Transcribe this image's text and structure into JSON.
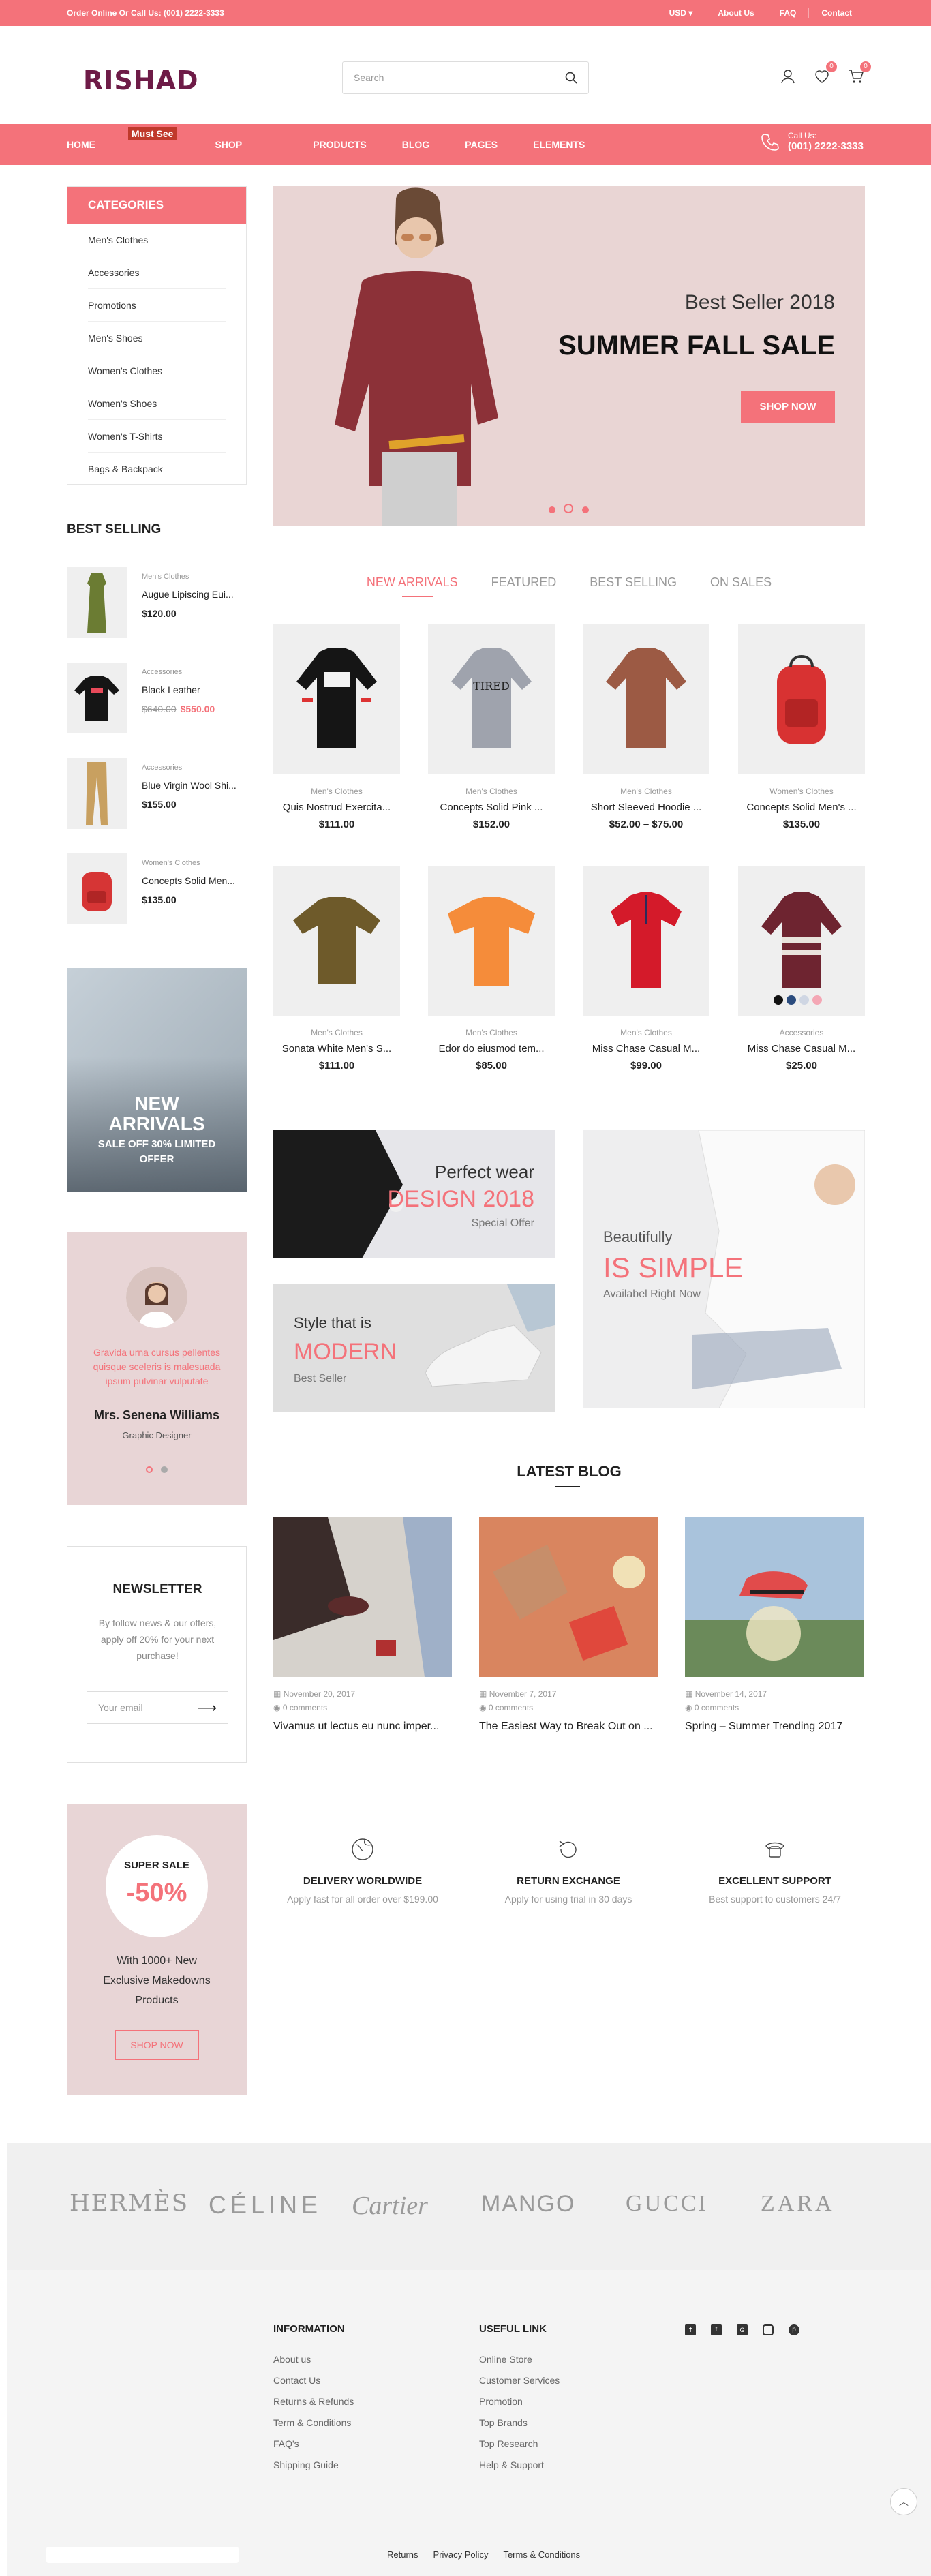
{
  "topbar": {
    "left": "Order Online Or Call Us: (001) 2222-3333",
    "currency": "USD",
    "about": "About Us",
    "faq": "FAQ",
    "contact": "Contact"
  },
  "header": {
    "logo": "RISHAD",
    "search_placeholder": "Search",
    "wishlist_count": "0",
    "cart_count": "0"
  },
  "nav": {
    "items": [
      "HOME",
      "SHOP",
      "PRODUCTS",
      "BLOG",
      "PAGES",
      "ELEMENTS"
    ],
    "shop_badge": "Must See",
    "call_label": "Call Us:",
    "call_number": "(001) 2222-3333"
  },
  "categories": {
    "title": "CATEGORIES",
    "items": [
      "Men's Clothes",
      "Accessories",
      "Promotions",
      "Men's Shoes",
      "Women's Clothes",
      "Women's Shoes",
      "Women's T-Shirts",
      "Bags & Backpack"
    ]
  },
  "best_selling": {
    "title": "BEST SELLING",
    "items": [
      {
        "cat": "Men's Clothes",
        "name": "Augue Lipiscing Eui...",
        "price": "$120.00",
        "old": ""
      },
      {
        "cat": "Accessories",
        "name": "Black Leather",
        "price": "$550.00",
        "old": "$640.00"
      },
      {
        "cat": "Accessories",
        "name": "Blue Virgin Wool Shi...",
        "price": "$155.00",
        "old": ""
      },
      {
        "cat": "Women's Clothes",
        "name": "Concepts Solid Men...",
        "price": "$135.00",
        "old": ""
      }
    ]
  },
  "promo_left": {
    "line1": "NEW",
    "line2": "ARRIVALS",
    "line3": "SALE OFF 30% LIMITED",
    "line4": "OFFER"
  },
  "testimonial": {
    "text": "Gravida urna cursus pellentes quisque sceleris is malesuada ipsum pulvinar vulputate",
    "name": "Mrs. Senena Williams",
    "role": "Graphic Designer"
  },
  "newsletter": {
    "title": "NEWSLETTER",
    "text": "By follow news & our offers, apply off 20% for your next purchase!",
    "placeholder": "Your email"
  },
  "sale_box": {
    "label": "SUPER SALE",
    "percent": "-50%",
    "text": "With 1000+ New Exclusive Makedowns Products",
    "button": "SHOP NOW"
  },
  "slider": {
    "subtitle": "Best Seller 2018",
    "title": "SUMMER FALL SALE",
    "button": "SHOP NOW"
  },
  "tabs": [
    "NEW ARRIVALS",
    "FEATURED",
    "BEST SELLING",
    "ON SALES"
  ],
  "products": [
    {
      "cat": "Men's Clothes",
      "name": "Quis Nostrud Exercita...",
      "price": "$111.00"
    },
    {
      "cat": "Men's Clothes",
      "name": "Concepts Solid Pink ...",
      "price": "$152.00"
    },
    {
      "cat": "Men's Clothes",
      "name": "Short Sleeved Hoodie ...",
      "price": "$52.00 – $75.00"
    },
    {
      "cat": "Women's Clothes",
      "name": "Concepts Solid Men's ...",
      "price": "$135.00"
    },
    {
      "cat": "Men's Clothes",
      "name": "Sonata White Men's S...",
      "price": "$111.00"
    },
    {
      "cat": "Men's Clothes",
      "name": "Edor do eiusmod tem...",
      "price": "$85.00"
    },
    {
      "cat": "Men's Clothes",
      "name": "Miss Chase Casual M...",
      "price": "$99.00"
    },
    {
      "cat": "Accessories",
      "name": "Miss Chase Casual M...",
      "price": "$25.00"
    }
  ],
  "tshirt_print": "TIRED",
  "banners": {
    "b1": {
      "l1": "Perfect wear",
      "l2": "DESIGN 2018",
      "l3": "Special Offer"
    },
    "b2": {
      "l1": "Style that is",
      "l2": "MODERN",
      "l3": "Best Seller"
    },
    "b3": {
      "l1": "Beautifully",
      "l2": "IS SIMPLE",
      "l3": "Availabel Right Now"
    }
  },
  "blog": {
    "title": "LATEST BLOG",
    "posts": [
      {
        "date": "November 20, 2017",
        "comments": "0 comments",
        "title": "Vivamus ut lectus eu nunc imper..."
      },
      {
        "date": "November 7, 2017",
        "comments": "0 comments",
        "title": "The Easiest Way to Break Out on ..."
      },
      {
        "date": "November 14, 2017",
        "comments": "0 comments",
        "title": "Spring – Summer Trending 2017"
      }
    ]
  },
  "features": [
    {
      "title": "DELIVERY WORLDWIDE",
      "sub": "Apply fast for all order over $199.00"
    },
    {
      "title": "RETURN EXCHANGE",
      "sub": "Apply for using trial in 30 days"
    },
    {
      "title": "EXCELLENT SUPPORT",
      "sub": "Best support to customers 24/7"
    }
  ],
  "brands": [
    "HERMÈS",
    "CÉLINE",
    "Cartier",
    "MANGO",
    "GUCCI",
    "ZARA"
  ],
  "footer": {
    "info_title": "INFORMATION",
    "info_links": [
      "About us",
      "Contact Us",
      "Returns & Refunds",
      "Term & Conditions",
      "FAQ's",
      "Shipping Guide"
    ],
    "useful_title": "USEFUL LINK",
    "useful_links": [
      "Online Store",
      "Customer Services",
      "Promotion",
      "Top Brands",
      "Top Research",
      "Help & Support"
    ],
    "bottom_links": [
      "Returns",
      "Privacy Policy",
      "Terms & Conditions"
    ]
  },
  "colors": {
    "accent": "#f4727a",
    "logo": "#6e1b47"
  }
}
